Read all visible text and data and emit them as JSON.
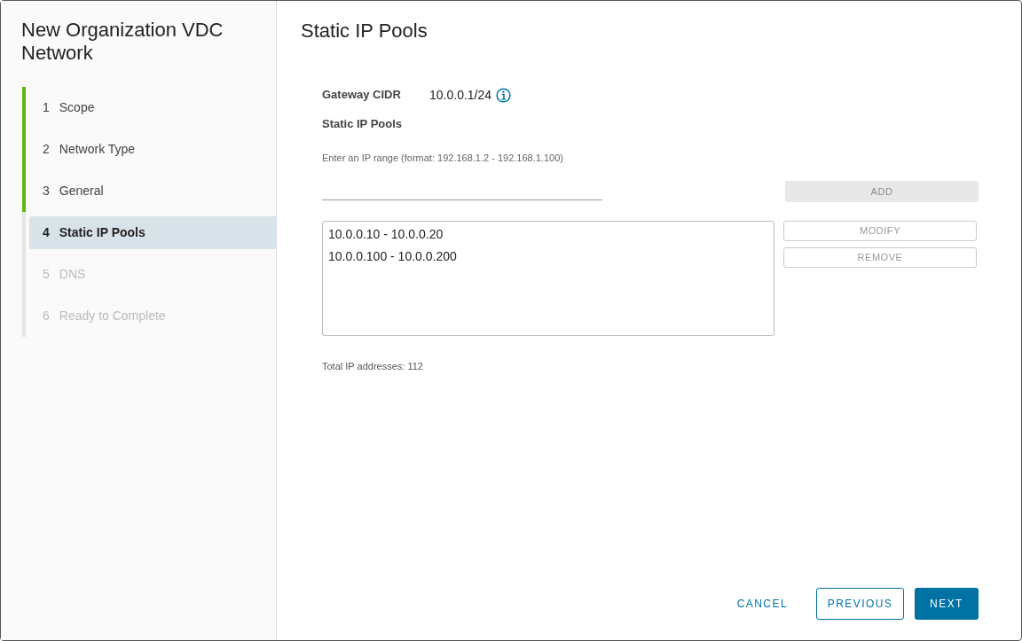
{
  "wizard": {
    "title": "New Organization VDC Network",
    "steps": [
      {
        "number": "1",
        "label": "Scope",
        "completed": true,
        "selected": false,
        "disabled": false
      },
      {
        "number": "2",
        "label": "Network Type",
        "completed": true,
        "selected": false,
        "disabled": false
      },
      {
        "number": "3",
        "label": "General",
        "completed": true,
        "selected": false,
        "disabled": false
      },
      {
        "number": "4",
        "label": "Static IP Pools",
        "completed": false,
        "selected": true,
        "disabled": false
      },
      {
        "number": "5",
        "label": "DNS",
        "completed": false,
        "selected": false,
        "disabled": true
      },
      {
        "number": "6",
        "label": "Ready to Complete",
        "completed": false,
        "selected": false,
        "disabled": true
      }
    ]
  },
  "page": {
    "title": "Static IP Pools",
    "gateway": {
      "label": "Gateway CIDR",
      "value": "10.0.0.1/24"
    },
    "pools_label": "Static IP Pools",
    "range_field": {
      "label": "Enter an IP range (format: 192.168.1.2 - 192.168.1.100)"
    },
    "add_button": {
      "label": "ADD",
      "disabled": true
    },
    "pools": [
      {
        "text": "10.0.0.10 - 10.0.0.20",
        "selected": false
      },
      {
        "text": "10.0.0.100 - 10.0.0.200",
        "selected": false
      }
    ],
    "list_buttons": [
      {
        "label": "MODIFY",
        "disabled": true
      },
      {
        "label": "REMOVE",
        "disabled": true
      }
    ],
    "total": "Total IP addresses: 112"
  },
  "footer": [
    {
      "label": "CANCEL",
      "kind": "link"
    },
    {
      "label": "PREVIOUS",
      "kind": "outline"
    },
    {
      "label": "NEXT",
      "kind": "primary"
    }
  ]
}
